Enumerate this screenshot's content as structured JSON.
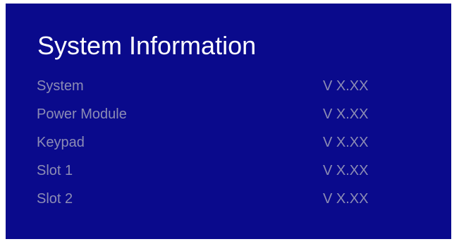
{
  "screen": {
    "title": "System Information",
    "rows": [
      {
        "label": "System",
        "value": "V X.XX"
      },
      {
        "label": "Power Module",
        "value": "V X.XX"
      },
      {
        "label": "Keypad",
        "value": "V X.XX"
      },
      {
        "label": "Slot 1",
        "value": "V X.XX"
      },
      {
        "label": "Slot 2",
        "value": "V X.XX"
      }
    ]
  },
  "colors": {
    "background": "#0a0a8c",
    "title_text": "#ffffff",
    "row_text": "#8c8cb4"
  }
}
